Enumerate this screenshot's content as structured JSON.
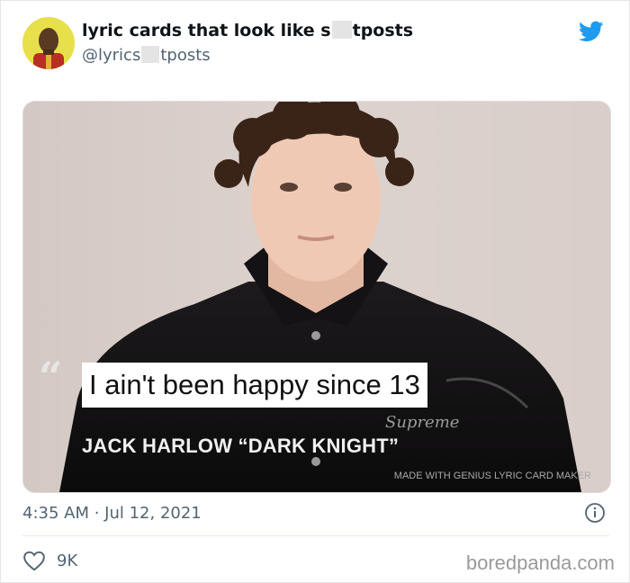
{
  "tweet": {
    "author_name_prefix": "lyric cards that look like s",
    "author_name_suffix": "tposts",
    "handle_prefix": "@lyrics",
    "handle_suffix": "tposts",
    "timestamp": "4:35 AM · Jul 12, 2021",
    "like_count": "9K"
  },
  "media": {
    "quote_mark": "“",
    "lyric": "I ain't been happy since 13",
    "credit": "JACK HARLOW “DARK KNIGHT”",
    "watermark": "MADE WITH GENIUS LYRIC CARD MAKER",
    "jacket_logo": "Supreme"
  },
  "footer": {
    "site": "boredpanda.com"
  },
  "icons": {
    "brand": "twitter-bird-icon",
    "info": "info-icon",
    "like": "heart-icon"
  },
  "colors": {
    "twitter_blue": "#1d9bf0",
    "muted_text": "#536471",
    "avatar_bg": "#e8e24e"
  }
}
